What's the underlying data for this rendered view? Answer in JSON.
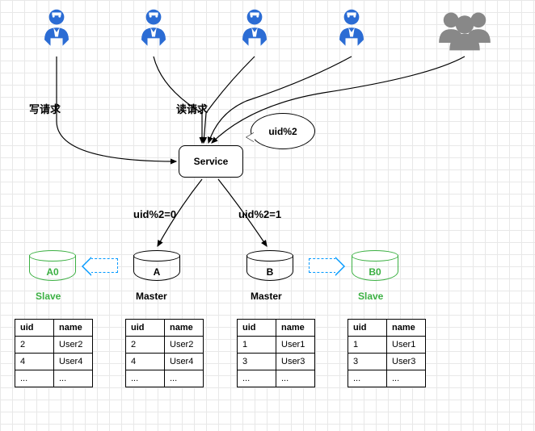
{
  "labels": {
    "write_request": "写请求",
    "read_request": "读请求",
    "service": "Service",
    "bubble": "uid%2",
    "branch_even": "uid%2=0",
    "branch_odd": "uid%2=1",
    "master": "Master",
    "slave": "Slave"
  },
  "cylinders": {
    "a0": "A0",
    "a": "A",
    "b": "B",
    "b0": "B0"
  },
  "tables": {
    "headers": {
      "uid": "uid",
      "name": "name"
    },
    "even_rows": [
      {
        "uid": "2",
        "name": "User2"
      },
      {
        "uid": "4",
        "name": "User4"
      },
      {
        "uid": "...",
        "name": "..."
      }
    ],
    "odd_rows": [
      {
        "uid": "1",
        "name": "User1"
      },
      {
        "uid": "3",
        "name": "User3"
      },
      {
        "uid": "...",
        "name": "..."
      }
    ]
  }
}
